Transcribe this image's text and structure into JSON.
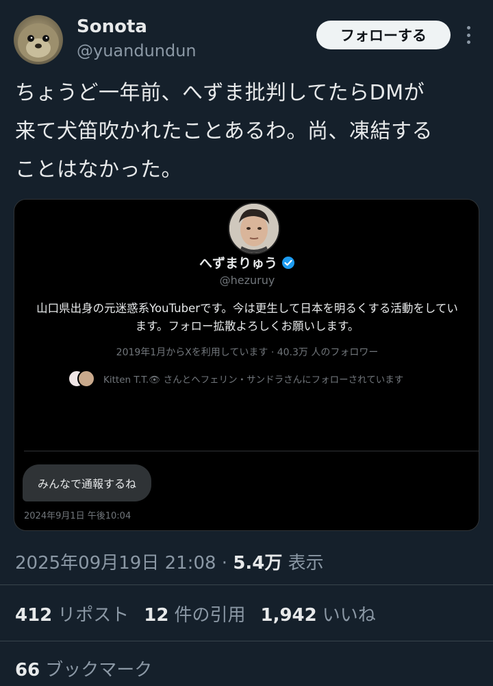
{
  "author": {
    "display_name": "Sonota",
    "handle": "@yuandundun",
    "follow_label": "フォローする"
  },
  "tweet": {
    "text_lines": [
      "ちょうど一年前、へずま批判してたらDMが",
      "来て犬笛吹かれたことあるわ。尚、凍結する",
      "ことはなかった。"
    ],
    "timestamp": "2025年09月19日 21:08",
    "separator": "·",
    "views_count": "5.4万",
    "views_label": "表示"
  },
  "embedded_dm": {
    "name": "へずまりゅう",
    "handle": "@hezuruy",
    "bio": "山口県出身の元迷惑系YouTuberです。今は更生して日本を明るくする活動をしています。フォロー拡散よろしくお願いします。",
    "meta": "2019年1月からXを利用しています · 40.3万 人のフォロワー",
    "followed_by": "Kitten T.T.👁 さんとヘフェリン・サンドラさんにフォローされています",
    "message": "みんなで通報するね",
    "message_time": "2024年9月1日 午後10:04",
    "verified_color": "#1d9bf0"
  },
  "stats": {
    "reposts_count": "412",
    "reposts_label": "リポスト",
    "quotes_count": "12",
    "quotes_label": "件の引用",
    "likes_count": "1,942",
    "likes_label": "いいね",
    "bookmarks_count": "66",
    "bookmarks_label": "ブックマーク"
  },
  "colors": {
    "background": "#15202b",
    "text_primary": "#e7e9ea",
    "text_secondary": "#8b98a5",
    "follow_button_bg": "#eff3f4"
  }
}
